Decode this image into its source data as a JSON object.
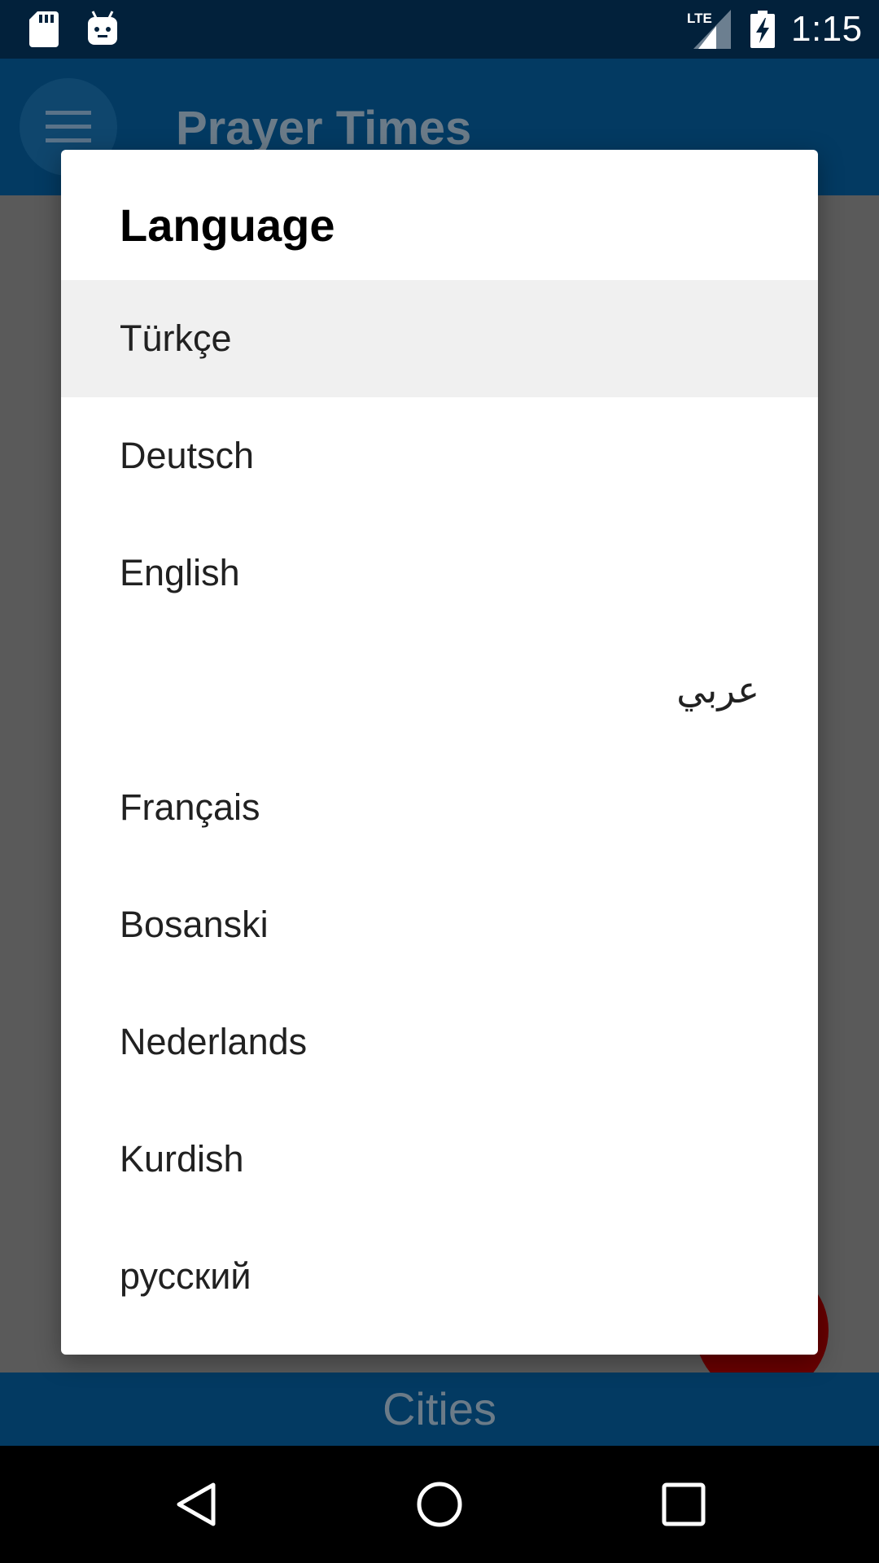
{
  "status_bar": {
    "time": "1:15",
    "network": "LTE",
    "icons": [
      "sd-card-icon",
      "android-icon",
      "lte-signal-icon",
      "battery-charging-icon"
    ]
  },
  "app_bar": {
    "title": "Prayer Times",
    "menu_icon": "hamburger-menu-icon"
  },
  "bottom_tab": {
    "label": "Cities"
  },
  "dialog": {
    "title": "Language",
    "items": [
      {
        "label": "Türkçe",
        "selected": true
      },
      {
        "label": "Deutsch"
      },
      {
        "label": "English"
      },
      {
        "label": "عربي",
        "rtl": true
      },
      {
        "label": "Français"
      },
      {
        "label": "Bosanski"
      },
      {
        "label": "Nederlands"
      },
      {
        "label": "Kurdish"
      },
      {
        "label": "русский"
      }
    ]
  },
  "nav_bar": {
    "icons": [
      "back-icon",
      "home-icon",
      "recents-icon"
    ]
  },
  "colors": {
    "status_bar": "#02213b",
    "app_bar": "#033a62",
    "scrim": "#5a5a5a",
    "fab": "#690000",
    "dialog_bg": "#ffffff",
    "selected_item": "#f0f0f0"
  }
}
